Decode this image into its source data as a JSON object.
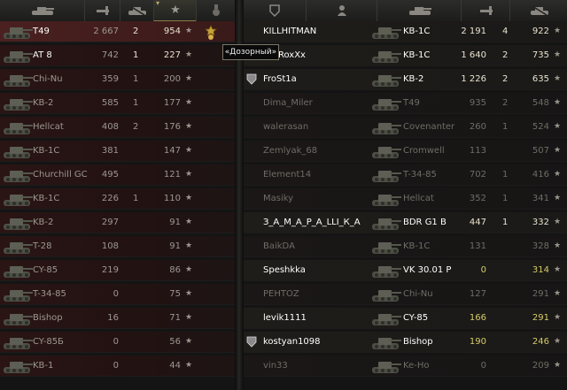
{
  "colors": {
    "sel_row": "#4a2020",
    "left_row": "#2a1414",
    "right_row": "#1a1716",
    "alive_text": "#ffffff",
    "yellow_value": "#d6cb6a"
  },
  "headers": {
    "left": [
      "tank-icon",
      "rank-icon",
      "kills-tank-icon",
      "sort-chevron-icon",
      "star-icon",
      "medal-column-icon"
    ],
    "right": [
      "badge-icon",
      "player-icon",
      "tank-icon",
      "rank-icon",
      "kills-tank-icon"
    ]
  },
  "tooltip": "«Дозорный»",
  "left_rows": [
    {
      "tank": "T49",
      "damage": "2 667",
      "kills": "2",
      "xp": "954",
      "selected": true,
      "alive": true
    },
    {
      "tank": "AT 8",
      "damage": "742",
      "kills": "1",
      "xp": "227",
      "alive": true
    },
    {
      "tank": "Chi-Nu",
      "damage": "359",
      "kills": "1",
      "xp": "200"
    },
    {
      "tank": "KB-2",
      "damage": "585",
      "kills": "1",
      "xp": "177"
    },
    {
      "tank": "Hellcat",
      "damage": "408",
      "kills": "2",
      "xp": "176"
    },
    {
      "tank": "KB-1C",
      "damage": "381",
      "kills": "",
      "xp": "147"
    },
    {
      "tank": "Churchill GC",
      "damage": "495",
      "kills": "",
      "xp": "121"
    },
    {
      "tank": "KB-1C",
      "damage": "226",
      "kills": "1",
      "xp": "110"
    },
    {
      "tank": "KB-2",
      "damage": "297",
      "kills": "",
      "xp": "91"
    },
    {
      "tank": "T-28",
      "damage": "108",
      "kills": "",
      "xp": "91"
    },
    {
      "tank": "CY-85",
      "damage": "219",
      "kills": "",
      "xp": "86"
    },
    {
      "tank": "T-34-85",
      "damage": "0",
      "kills": "",
      "xp": "75"
    },
    {
      "tank": "Bishop",
      "damage": "16",
      "kills": "",
      "xp": "71"
    },
    {
      "tank": "CY-85Б",
      "damage": "0",
      "kills": "",
      "xp": "56"
    },
    {
      "tank": "KB-1",
      "damage": "0",
      "kills": "",
      "xp": "44"
    }
  ],
  "right_rows": [
    {
      "player": "KILLHITMAN",
      "tank": "KB-1C",
      "damage": "2 191",
      "kills": "4",
      "xp": "922",
      "alive": true
    },
    {
      "player": "ArPRoxXx",
      "tank": "KB-1C",
      "damage": "1 640",
      "kills": "2",
      "xp": "735",
      "alive": true
    },
    {
      "player": "FroSt1a",
      "tank": "KB-2",
      "damage": "1 226",
      "kills": "2",
      "xp": "635",
      "alive": true,
      "badge": true
    },
    {
      "player": "Dima_Miler",
      "tank": "T49",
      "damage": "935",
      "kills": "2",
      "xp": "548"
    },
    {
      "player": "walerasan",
      "tank": "Covenanter",
      "damage": "260",
      "kills": "1",
      "xp": "524"
    },
    {
      "player": "Zemlyak_68",
      "tank": "Cromwell",
      "damage": "113",
      "kills": "",
      "xp": "507"
    },
    {
      "player": "Element14",
      "tank": "T-34-85",
      "damage": "702",
      "kills": "1",
      "xp": "416"
    },
    {
      "player": "Masiky",
      "tank": "Hellcat",
      "damage": "352",
      "kills": "1",
      "xp": "341"
    },
    {
      "player": "З_А_М_А_Р_А_LLI_К_А",
      "tank": "BDR G1 B",
      "damage": "447",
      "kills": "1",
      "xp": "332",
      "alive": true
    },
    {
      "player": "BaikDA",
      "tank": "KB-1C",
      "damage": "131",
      "kills": "",
      "xp": "328"
    },
    {
      "player": "Speshkka",
      "tank": "VK 30.01 P",
      "damage": "0",
      "kills": "",
      "xp": "314",
      "alive": true,
      "yellow": true
    },
    {
      "player": "PEHTOZ",
      "tank": "Chi-Nu",
      "damage": "127",
      "kills": "",
      "xp": "291"
    },
    {
      "player": "levik1111",
      "tank": "CY-85",
      "damage": "166",
      "kills": "",
      "xp": "291",
      "alive": true,
      "yellow": true
    },
    {
      "player": "kostyan1098",
      "tank": "Bishop",
      "damage": "190",
      "kills": "",
      "xp": "246",
      "alive": true,
      "yellow": true,
      "badge": true
    },
    {
      "player": "vin33",
      "tank": "Ke-Ho",
      "damage": "0",
      "kills": "",
      "xp": "209"
    }
  ]
}
